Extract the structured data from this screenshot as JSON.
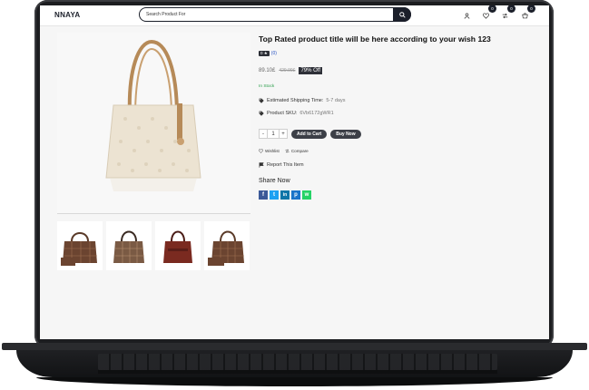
{
  "header": {
    "logo": "NNAYA",
    "search": {
      "placeholder": "Search Product For",
      "value": ""
    },
    "icons": [
      {
        "name": "user-icon"
      },
      {
        "name": "heart-icon",
        "badge": "0"
      },
      {
        "name": "compare-icon",
        "badge": "0"
      },
      {
        "name": "cart-icon",
        "badge": "0"
      }
    ]
  },
  "product": {
    "title": "Top Rated product title will be here according to your wish 123",
    "rating": {
      "value": "0 ★",
      "count": "(0)"
    },
    "price": "89.10£",
    "old_price": "429.99£",
    "discount": "79% Off",
    "stock": "In Stock",
    "shipping": {
      "label": "Estimated Shipping Time:",
      "value": "5-7 days"
    },
    "sku": {
      "label": "Product SKU:",
      "value": "6Vb6172gWR1"
    },
    "quantity": "1",
    "qty_minus": "-",
    "qty_plus": "+",
    "add_to_cart": "Add to Cart",
    "buy_now": "Buy Now",
    "wishlist": "Wishlist",
    "compare": "Compare",
    "report": "Report This Item",
    "share_title": "Share Now",
    "share": [
      {
        "name": "facebook",
        "glyph": "f",
        "color": "#3b5998"
      },
      {
        "name": "twitter",
        "glyph": "t",
        "color": "#1da1f2"
      },
      {
        "name": "linkedin",
        "glyph": "in",
        "color": "#0e76a8"
      },
      {
        "name": "pinterest",
        "glyph": "p",
        "color": "#1a73c9"
      },
      {
        "name": "whatsapp",
        "glyph": "w",
        "color": "#25d366"
      }
    ]
  },
  "gallery": {
    "main_image": "cream-tote-bag",
    "thumbnails": [
      "checkered-tote-1",
      "checkered-tote-2",
      "burgundy-tote",
      "checkered-tote-3"
    ]
  },
  "colors": {
    "accent": "#1b1f2a",
    "stock": "#2a9d4a",
    "pill": "#3c3f47"
  }
}
